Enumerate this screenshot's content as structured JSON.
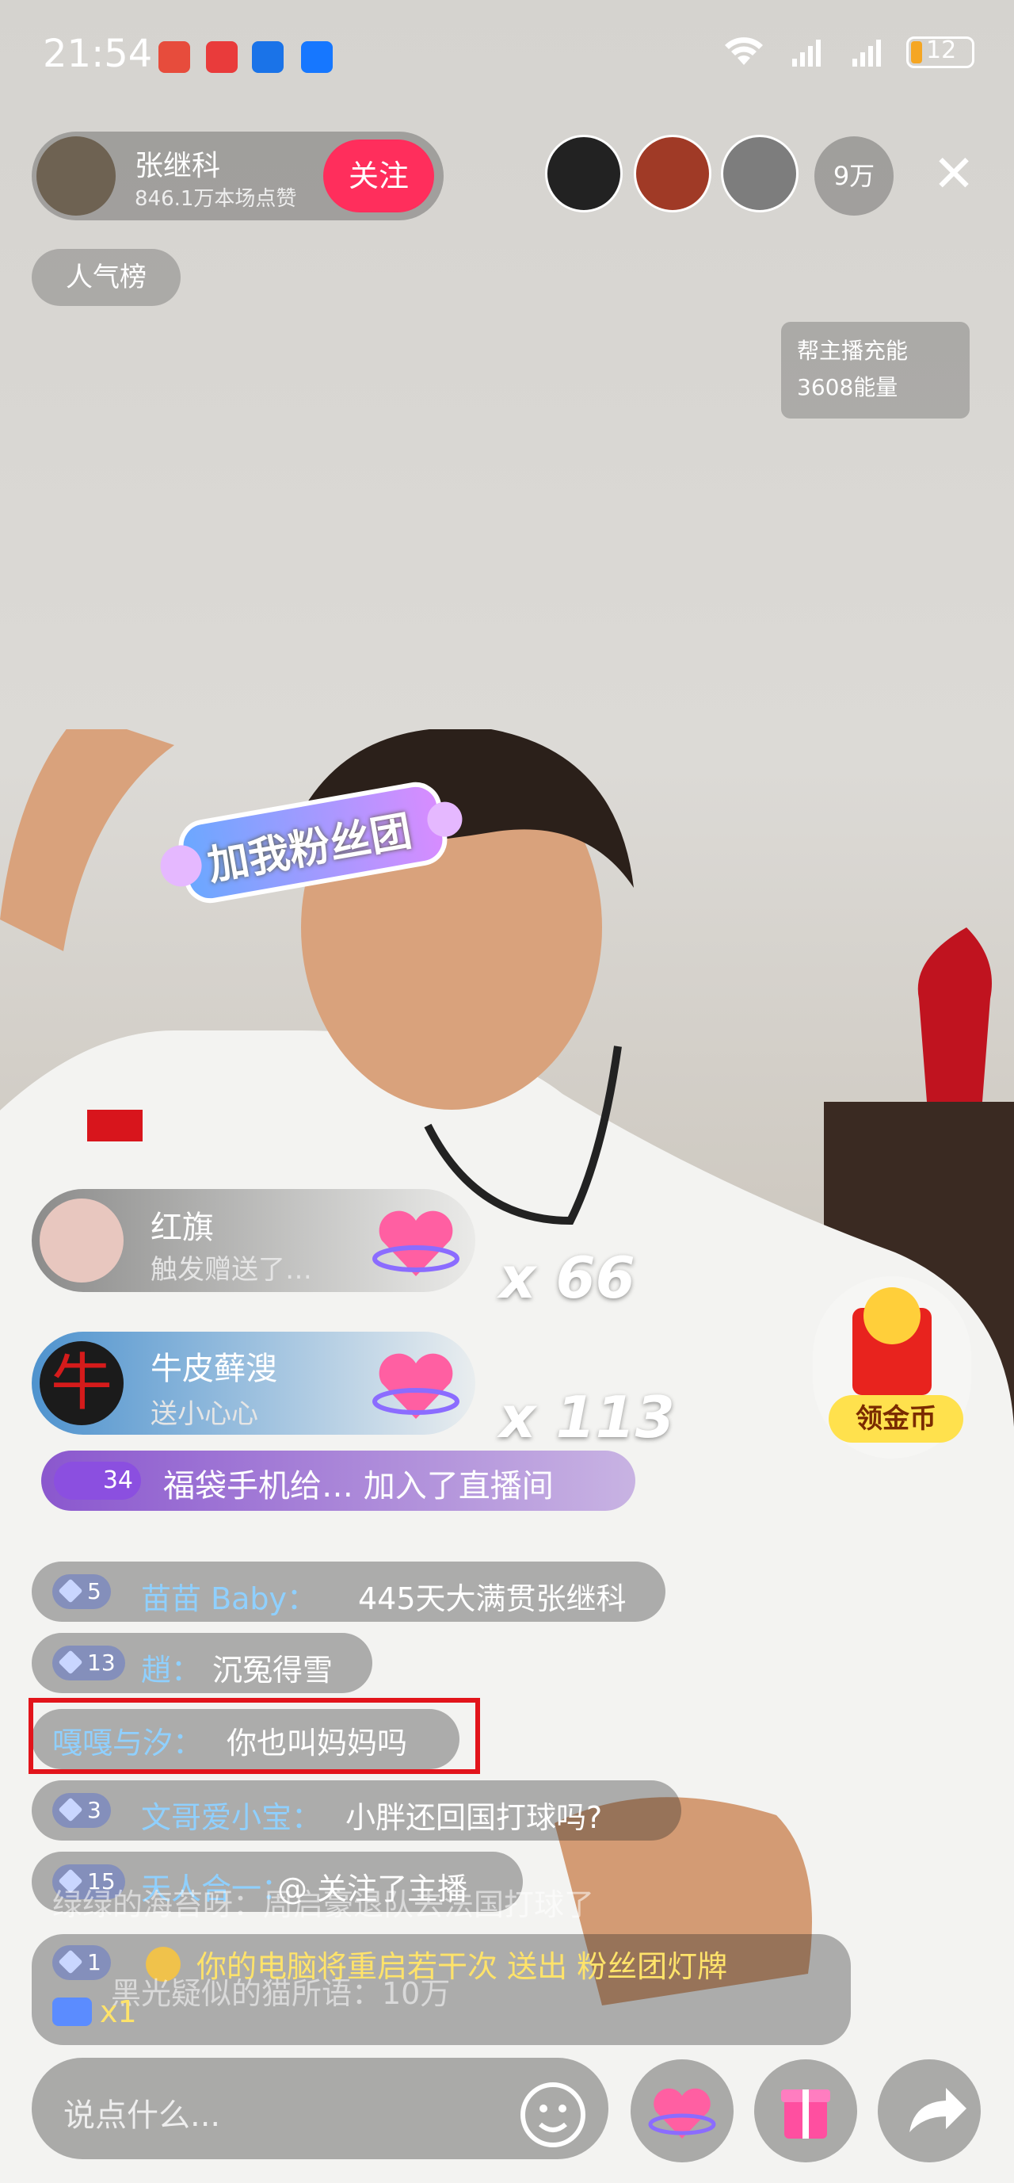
{
  "status_bar": {
    "time": "21:54",
    "battery": "12"
  },
  "host": {
    "name": "张继科",
    "likes": "846.1万本场点赞",
    "follow_label": "关注"
  },
  "viewers": {
    "count": "9万"
  },
  "rank_label": "人气榜",
  "charge": {
    "title": "帮主播充能",
    "value": "3608能量"
  },
  "sticker_text": "加我粉丝团",
  "gifts": [
    {
      "user": "红旗",
      "action": "触发赠送了…",
      "combo": "x 66"
    },
    {
      "user": "牛皮藓溲",
      "action": "送小心心",
      "combo": "x 113"
    }
  ],
  "coin_label": "领金币",
  "join": {
    "level": "34",
    "text": "福袋手机给… 加入了直播间"
  },
  "comments": [
    {
      "level": "5",
      "user": "苗苗 Baby：",
      "text": "445天大满贯张继科"
    },
    {
      "level": "13",
      "user": "趙：",
      "text": "沉冤得雪"
    },
    {
      "level": "",
      "user": "嘎嘎与汐：",
      "text": "你也叫妈妈吗"
    },
    {
      "level": "3",
      "user": "文哥爱小宝：",
      "text": "小胖还回国打球吗?"
    },
    {
      "level": "15",
      "user": "天人合一：",
      "text": "@ 关注了主播"
    },
    {
      "level": "1",
      "user": "",
      "text": "你的电脑将重启若干次 送出 粉丝团灯牌"
    }
  ],
  "ghost_comments": [
    "绿绿的海苔呀：周启豪退队去法国打球了",
    "黑光疑似的猫所语：10万"
  ],
  "gift_small": "x1",
  "input_placeholder": "说点什么..."
}
